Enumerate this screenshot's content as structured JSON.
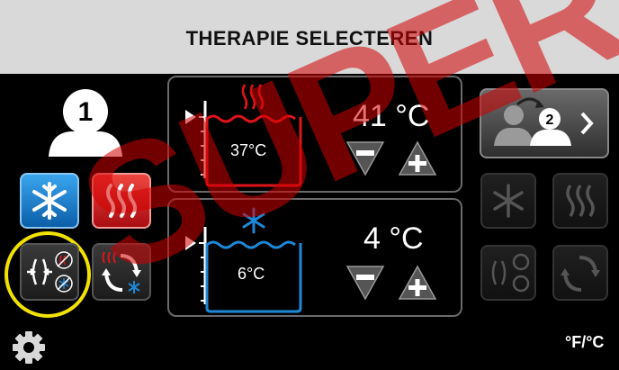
{
  "header": {
    "title": "THERAPIE SELECTEREN"
  },
  "patient": {
    "number": "1",
    "next_number": "2"
  },
  "hot_panel": {
    "set_temp": "41 °C",
    "current_temp": "37°C"
  },
  "cold_panel": {
    "set_temp": "4 °C",
    "current_temp": "6°C"
  },
  "unit_toggle": {
    "label": "°F/°C"
  },
  "watermark": {
    "text": "SUPER"
  },
  "colors": {
    "hot": "#e0141a",
    "cold": "#1e88d8",
    "highlight": "#f2e100"
  }
}
